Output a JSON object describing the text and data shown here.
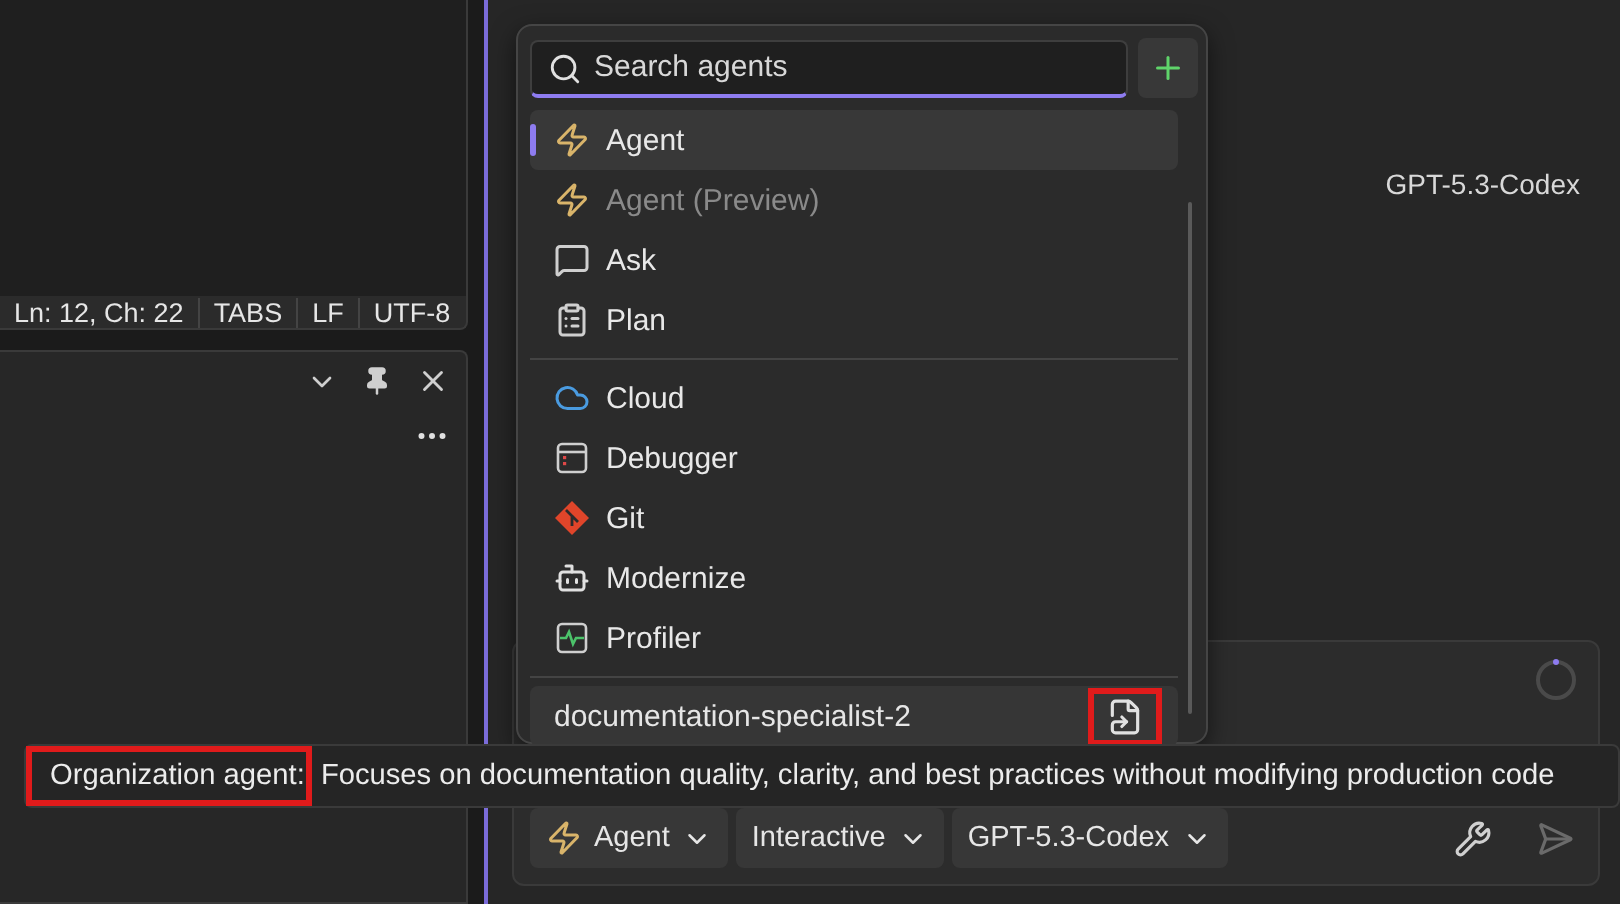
{
  "status_bar": [
    "Ln: 12, Ch: 22",
    "TABS",
    "LF",
    "UTF-8"
  ],
  "chat": {
    "model_label": "GPT-5.3-Codex"
  },
  "agent_menu": {
    "search": {
      "placeholder": "Search agents"
    },
    "groups": [
      [
        {
          "label": "Agent",
          "selected": true,
          "disabled": false
        },
        {
          "label": "Agent (Preview)",
          "selected": false,
          "disabled": true
        },
        {
          "label": "Ask",
          "selected": false,
          "disabled": false
        },
        {
          "label": "Plan",
          "selected": false,
          "disabled": false
        }
      ],
      [
        {
          "label": "Cloud",
          "selected": false,
          "disabled": false
        },
        {
          "label": "Debugger",
          "selected": false,
          "disabled": false
        },
        {
          "label": "Git",
          "selected": false,
          "disabled": false
        },
        {
          "label": "Modernize",
          "selected": false,
          "disabled": false
        },
        {
          "label": "Profiler",
          "selected": false,
          "disabled": false
        }
      ]
    ],
    "custom": [
      {
        "label": "documentation-specialist-2"
      }
    ]
  },
  "tooltip": {
    "label": "Organization agent:",
    "text": "Focuses on documentation quality, clarity, and best practices without modifying production code"
  },
  "toolbar": [
    {
      "label": "Agent",
      "kind": "agent"
    },
    {
      "label": "Interactive",
      "kind": "plain"
    },
    {
      "label": "GPT-5.3-Codex",
      "kind": "plain"
    }
  ]
}
